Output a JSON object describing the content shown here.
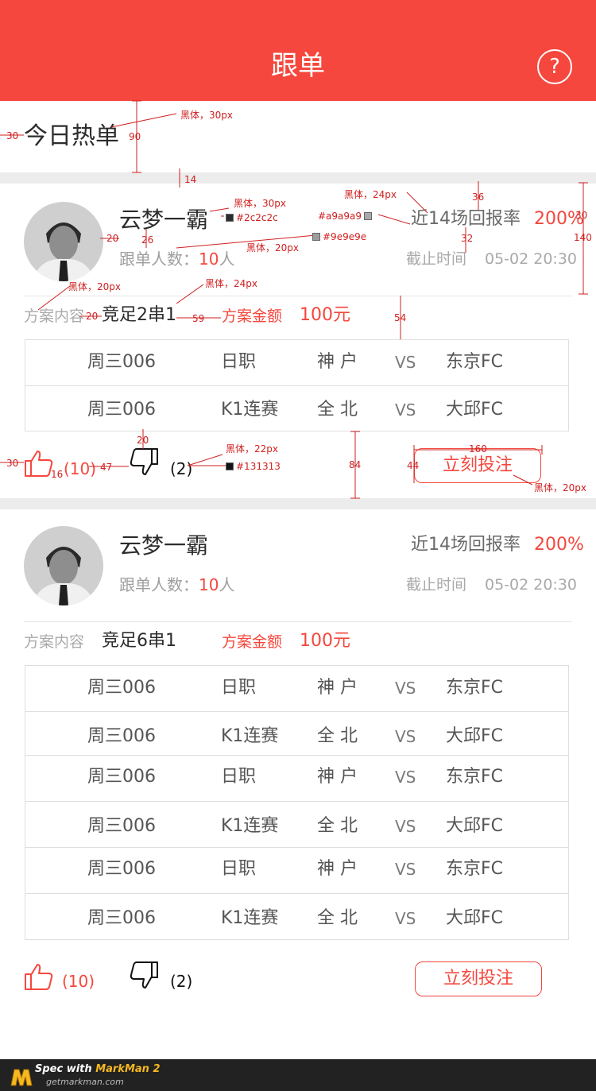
{
  "header": {
    "title": "跟单",
    "help_glyph": "?"
  },
  "section_title": "今日热单",
  "colors": {
    "brand_red": "#f5473d",
    "text_dark": "#2c2c2c",
    "text_gray": "#9e9e9e",
    "text_light": "#a9a9a9",
    "icon_black": "#131313"
  },
  "cards": [
    {
      "username": "云梦一霸",
      "followers_label": "跟单人数：",
      "followers_count": "10",
      "followers_unit": "人",
      "rate_label": "近14场回报率",
      "rate_value": "200%",
      "deadline_label": "截止时间",
      "deadline_value": "05-02 20:30",
      "plan_label": "方案内容",
      "plan_value": "竞足2串1",
      "amount_label": "方案金额",
      "amount_value": "100元",
      "matches": [
        {
          "day": "周三006",
          "league": "日职",
          "home": "神 户",
          "vs": "VS",
          "away": "东京FC"
        },
        {
          "day": "周三006",
          "league": "K1连赛",
          "home": "全 北",
          "vs": "VS",
          "away": "大邱FC"
        }
      ],
      "likes": "(10)",
      "dislikes": "(2)",
      "bet_label": "立刻投注"
    },
    {
      "username": "云梦一霸",
      "followers_label": "跟单人数：",
      "followers_count": "10",
      "followers_unit": "人",
      "rate_label": "近14场回报率",
      "rate_value": "200%",
      "deadline_label": "截止时间",
      "deadline_value": "05-02 20:30",
      "plan_label": "方案内容",
      "plan_value": "竞足6串1",
      "amount_label": "方案金额",
      "amount_value": "100元",
      "matches": [
        {
          "day": "周三006",
          "league": "日职",
          "home": "神 户",
          "vs": "VS",
          "away": "东京FC"
        },
        {
          "day": "周三006",
          "league": "K1连赛",
          "home": "全 北",
          "vs": "VS",
          "away": "大邱FC"
        },
        {
          "day": "周三006",
          "league": "日职",
          "home": "神 户",
          "vs": "VS",
          "away": "东京FC"
        },
        {
          "day": "周三006",
          "league": "K1连赛",
          "home": "全 北",
          "vs": "VS",
          "away": "大邱FC"
        },
        {
          "day": "周三006",
          "league": "日职",
          "home": "神 户",
          "vs": "VS",
          "away": "东京FC"
        },
        {
          "day": "周三006",
          "league": "K1连赛",
          "home": "全 北",
          "vs": "VS",
          "away": "大邱FC"
        }
      ],
      "likes": "(10)",
      "dislikes": "(2)",
      "bet_label": "立刻投注"
    }
  ],
  "annotations": [
    "黑体，30px",
    "90",
    "30",
    "14",
    "黑体，30px",
    "#2c2c2c",
    "黑体，24px",
    "#a9a9a9",
    "36",
    "30",
    "140",
    "20",
    "26",
    "#9e9e9e",
    "黑体，20px",
    "32",
    "黑体，20px",
    "黑体，24px",
    "20",
    "59",
    "54",
    "20",
    "黑体，22px",
    "#131313",
    "160",
    "30",
    "16",
    "47",
    "84",
    "44",
    "黑体，20px"
  ],
  "footer": {
    "spec_with": "Spec with ",
    "brand": "MarkMan 2",
    "url": "getmarkman.com"
  }
}
